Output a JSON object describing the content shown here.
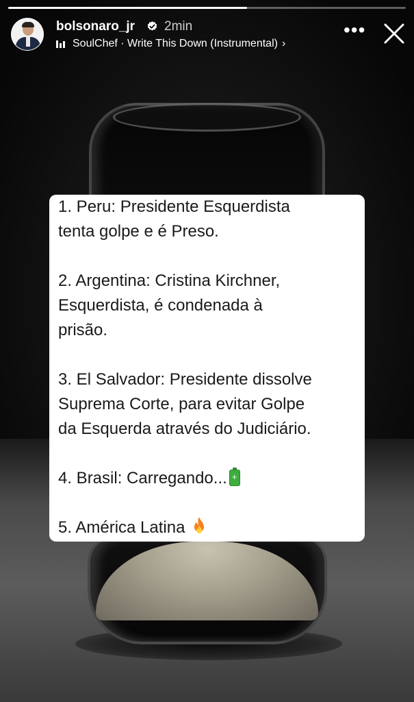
{
  "progress": {
    "fraction": 0.6
  },
  "header": {
    "username": "bolsonaro_jr",
    "verified": true,
    "time": "2min",
    "music": {
      "text": "SoulChef · Write This Down (Instrumental)",
      "chevron": "›"
    },
    "more_label": "•••",
    "icons": [
      "avatar",
      "verified-badge-icon",
      "music-bars-icon",
      "more-icon",
      "close-icon"
    ]
  },
  "card": {
    "item1_line1": "1. Peru: Presidente Esquerdista",
    "item1_line2": "tenta golpe e é Preso.",
    "item2_line1": "2. Argentina: Cristina Kirchner,",
    "item2_line2": "Esquerdista, é condenada à",
    "item2_line3": "prisão.",
    "item3_line1": "3. El Salvador: Presidente dissolve",
    "item3_line2": "Suprema Corte, para evitar Golpe",
    "item3_line3": "da Esquerda através do Judiciário.",
    "item4": "4. Brasil: Carregando...",
    "item4_emoji": "battery-icon",
    "item5": "5. América Latina",
    "item5_emoji": "fire-icon"
  },
  "colors": {
    "card_bg": "#ffffff",
    "text": "#1a1a1a",
    "header_text": "#ffffff",
    "battery": "#3fae3f",
    "fire": "#f5821f"
  }
}
